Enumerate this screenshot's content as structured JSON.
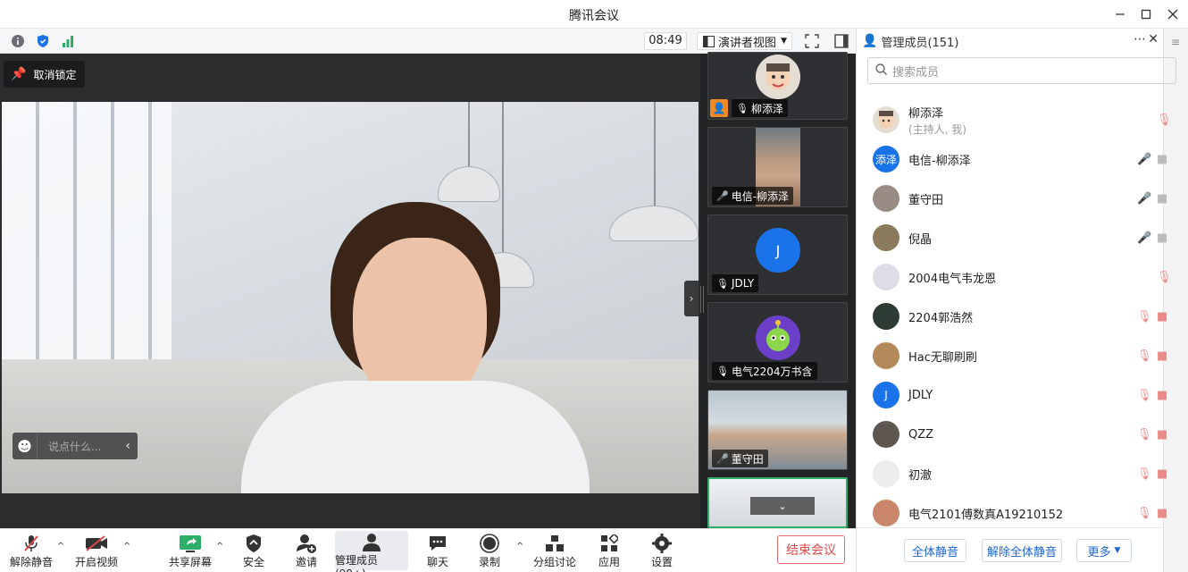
{
  "window": {
    "title": "腾讯会议"
  },
  "topbar": {
    "time": "08:49",
    "view_mode": "演讲者视图"
  },
  "stage": {
    "unpin_label": "取消锁定",
    "chat_placeholder": "说点什么..."
  },
  "thumbnails": [
    {
      "name": "柳添泽",
      "muted": true
    },
    {
      "name": "电信-柳添泽",
      "muted": false
    },
    {
      "name": "JDLY",
      "muted": true,
      "initial": "J"
    },
    {
      "name": "电气2204万书含",
      "muted": true
    },
    {
      "name": "董守田",
      "muted": false
    },
    {
      "name": "",
      "muted": false
    }
  ],
  "controls": {
    "unmute": "解除静音",
    "start_video": "开启视频",
    "share_screen": "共享屏幕",
    "security": "安全",
    "invite": "邀请",
    "manage_members": "管理成员(99+)",
    "chat": "聊天",
    "record": "录制",
    "breakout": "分组讨论",
    "apps": "应用",
    "settings": "设置",
    "end_meeting": "结束会议"
  },
  "panel": {
    "title": "管理成员(151)",
    "search_placeholder": "搜索成员",
    "members": [
      {
        "name": "柳添泽",
        "sub": "(主持人, 我)",
        "mic": "muted",
        "video": "none"
      },
      {
        "name": "电信-柳添泽",
        "avatar_text": "添泽",
        "mic": "on",
        "video": "on"
      },
      {
        "name": "董守田",
        "mic": "on",
        "video": "on"
      },
      {
        "name": "倪晶",
        "mic": "on",
        "video": "on"
      },
      {
        "name": "2004电气韦龙恩",
        "mic": "muted",
        "video": "none"
      },
      {
        "name": "2204郭浩然",
        "mic": "muted",
        "video": "off"
      },
      {
        "name": "Hac无聊刷刷",
        "mic": "muted",
        "video": "off"
      },
      {
        "name": "JDLY",
        "avatar_text": "J",
        "mic": "muted",
        "video": "off"
      },
      {
        "name": "QZZ",
        "mic": "muted",
        "video": "off"
      },
      {
        "name": "初澈",
        "mic": "muted",
        "video": "off"
      },
      {
        "name": "电气2101傅数真A19210152",
        "mic": "muted",
        "video": "off"
      }
    ],
    "mute_all": "全体静音",
    "unmute_all": "解除全体静音",
    "more": "更多"
  },
  "colors": {
    "accent_blue": "#1e64d2",
    "end_red": "#e04848",
    "active_green": "#2fae6a",
    "avatar_blue": "#1a73e8"
  }
}
